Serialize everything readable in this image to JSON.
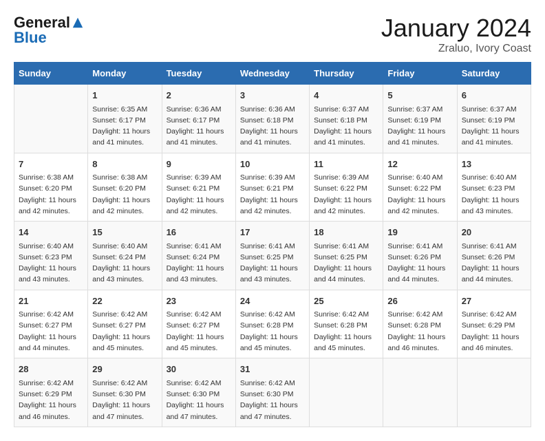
{
  "header": {
    "logo_general": "General",
    "logo_blue": "Blue",
    "month_title": "January 2024",
    "subtitle": "Zraluo, Ivory Coast"
  },
  "days_of_week": [
    "Sunday",
    "Monday",
    "Tuesday",
    "Wednesday",
    "Thursday",
    "Friday",
    "Saturday"
  ],
  "weeks": [
    [
      {
        "day": "",
        "info": ""
      },
      {
        "day": "1",
        "info": "Sunrise: 6:35 AM\nSunset: 6:17 PM\nDaylight: 11 hours\nand 41 minutes."
      },
      {
        "day": "2",
        "info": "Sunrise: 6:36 AM\nSunset: 6:17 PM\nDaylight: 11 hours\nand 41 minutes."
      },
      {
        "day": "3",
        "info": "Sunrise: 6:36 AM\nSunset: 6:18 PM\nDaylight: 11 hours\nand 41 minutes."
      },
      {
        "day": "4",
        "info": "Sunrise: 6:37 AM\nSunset: 6:18 PM\nDaylight: 11 hours\nand 41 minutes."
      },
      {
        "day": "5",
        "info": "Sunrise: 6:37 AM\nSunset: 6:19 PM\nDaylight: 11 hours\nand 41 minutes."
      },
      {
        "day": "6",
        "info": "Sunrise: 6:37 AM\nSunset: 6:19 PM\nDaylight: 11 hours\nand 41 minutes."
      }
    ],
    [
      {
        "day": "7",
        "info": "Sunrise: 6:38 AM\nSunset: 6:20 PM\nDaylight: 11 hours\nand 42 minutes."
      },
      {
        "day": "8",
        "info": "Sunrise: 6:38 AM\nSunset: 6:20 PM\nDaylight: 11 hours\nand 42 minutes."
      },
      {
        "day": "9",
        "info": "Sunrise: 6:39 AM\nSunset: 6:21 PM\nDaylight: 11 hours\nand 42 minutes."
      },
      {
        "day": "10",
        "info": "Sunrise: 6:39 AM\nSunset: 6:21 PM\nDaylight: 11 hours\nand 42 minutes."
      },
      {
        "day": "11",
        "info": "Sunrise: 6:39 AM\nSunset: 6:22 PM\nDaylight: 11 hours\nand 42 minutes."
      },
      {
        "day": "12",
        "info": "Sunrise: 6:40 AM\nSunset: 6:22 PM\nDaylight: 11 hours\nand 42 minutes."
      },
      {
        "day": "13",
        "info": "Sunrise: 6:40 AM\nSunset: 6:23 PM\nDaylight: 11 hours\nand 43 minutes."
      }
    ],
    [
      {
        "day": "14",
        "info": "Sunrise: 6:40 AM\nSunset: 6:23 PM\nDaylight: 11 hours\nand 43 minutes."
      },
      {
        "day": "15",
        "info": "Sunrise: 6:40 AM\nSunset: 6:24 PM\nDaylight: 11 hours\nand 43 minutes."
      },
      {
        "day": "16",
        "info": "Sunrise: 6:41 AM\nSunset: 6:24 PM\nDaylight: 11 hours\nand 43 minutes."
      },
      {
        "day": "17",
        "info": "Sunrise: 6:41 AM\nSunset: 6:25 PM\nDaylight: 11 hours\nand 43 minutes."
      },
      {
        "day": "18",
        "info": "Sunrise: 6:41 AM\nSunset: 6:25 PM\nDaylight: 11 hours\nand 44 minutes."
      },
      {
        "day": "19",
        "info": "Sunrise: 6:41 AM\nSunset: 6:26 PM\nDaylight: 11 hours\nand 44 minutes."
      },
      {
        "day": "20",
        "info": "Sunrise: 6:41 AM\nSunset: 6:26 PM\nDaylight: 11 hours\nand 44 minutes."
      }
    ],
    [
      {
        "day": "21",
        "info": "Sunrise: 6:42 AM\nSunset: 6:27 PM\nDaylight: 11 hours\nand 44 minutes."
      },
      {
        "day": "22",
        "info": "Sunrise: 6:42 AM\nSunset: 6:27 PM\nDaylight: 11 hours\nand 45 minutes."
      },
      {
        "day": "23",
        "info": "Sunrise: 6:42 AM\nSunset: 6:27 PM\nDaylight: 11 hours\nand 45 minutes."
      },
      {
        "day": "24",
        "info": "Sunrise: 6:42 AM\nSunset: 6:28 PM\nDaylight: 11 hours\nand 45 minutes."
      },
      {
        "day": "25",
        "info": "Sunrise: 6:42 AM\nSunset: 6:28 PM\nDaylight: 11 hours\nand 45 minutes."
      },
      {
        "day": "26",
        "info": "Sunrise: 6:42 AM\nSunset: 6:28 PM\nDaylight: 11 hours\nand 46 minutes."
      },
      {
        "day": "27",
        "info": "Sunrise: 6:42 AM\nSunset: 6:29 PM\nDaylight: 11 hours\nand 46 minutes."
      }
    ],
    [
      {
        "day": "28",
        "info": "Sunrise: 6:42 AM\nSunset: 6:29 PM\nDaylight: 11 hours\nand 46 minutes."
      },
      {
        "day": "29",
        "info": "Sunrise: 6:42 AM\nSunset: 6:30 PM\nDaylight: 11 hours\nand 47 minutes."
      },
      {
        "day": "30",
        "info": "Sunrise: 6:42 AM\nSunset: 6:30 PM\nDaylight: 11 hours\nand 47 minutes."
      },
      {
        "day": "31",
        "info": "Sunrise: 6:42 AM\nSunset: 6:30 PM\nDaylight: 11 hours\nand 47 minutes."
      },
      {
        "day": "",
        "info": ""
      },
      {
        "day": "",
        "info": ""
      },
      {
        "day": "",
        "info": ""
      }
    ]
  ]
}
